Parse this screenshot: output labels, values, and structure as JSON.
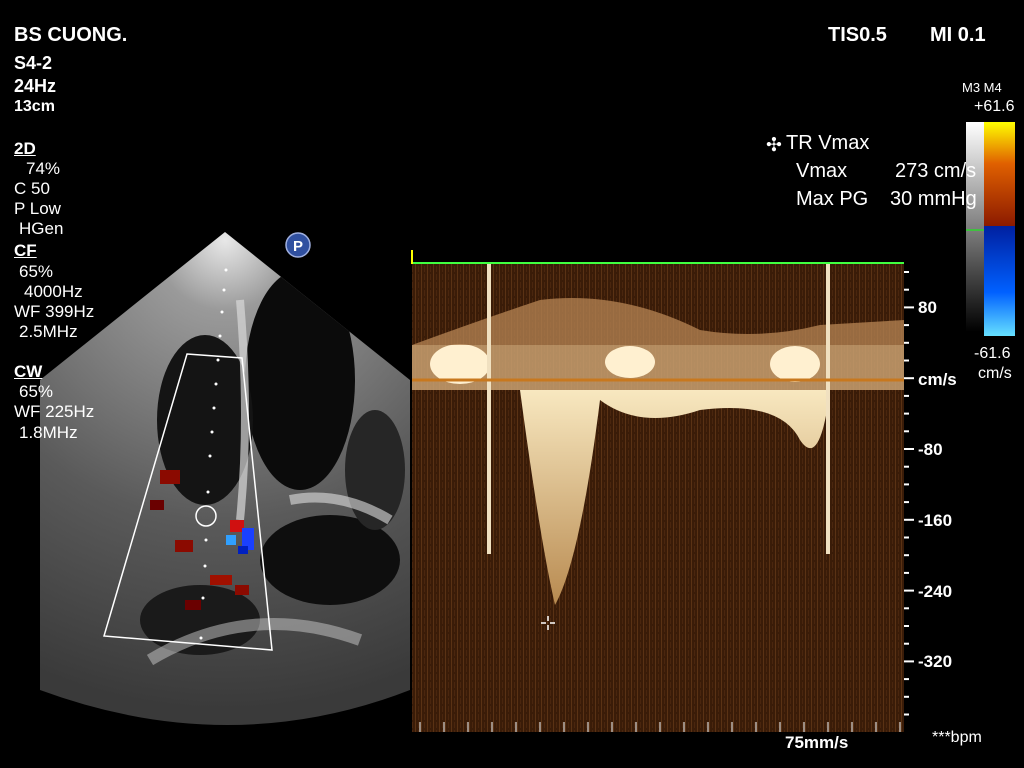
{
  "header": {
    "operator": "BS CUONG.",
    "thermal_index": "TIS0.5",
    "mech_index": "MI 0.1"
  },
  "probe": {
    "model": "S4-2",
    "frame_rate": "24Hz",
    "depth": "13cm"
  },
  "params_2d": {
    "title": "2D",
    "gain": "74%",
    "compression": "C 50",
    "persistence": "P Low",
    "frequency": "HGen"
  },
  "params_cf": {
    "title": "CF",
    "gain": "65%",
    "prf": "4000Hz",
    "wall_filter": "WF 399Hz",
    "frequency": "2.5MHz"
  },
  "params_cw": {
    "title": "CW",
    "gain": "65%",
    "wall_filter": "WF 225Hz",
    "frequency": "1.8MHz"
  },
  "preset_badge": "P",
  "measurement": {
    "title": "TR Vmax",
    "vmax_label": "Vmax",
    "vmax_value": "273 cm/s",
    "pg_label": "Max PG",
    "pg_value": "30 mmHg"
  },
  "colorbar": {
    "map_label": "M3 M4",
    "top_value": "+61.6",
    "bottom_value": "-61.6",
    "unit": "cm/s",
    "colors": {
      "top": "#ffff00",
      "mid_pos": "#8b1a00",
      "mid_neg": "#0020a0",
      "bottom": "#66e0ff"
    }
  },
  "spectral": {
    "unit": "cm/s",
    "tick_labels": [
      "80",
      "-80",
      "-160",
      "-240",
      "-320"
    ],
    "sweep_speed": "75mm/s",
    "heart_rate": "***bpm",
    "colors": {
      "background": "#3a1c08",
      "signal": "#f5dfb0",
      "baseline": "#c8781e",
      "ecg": "#40ff40"
    }
  }
}
